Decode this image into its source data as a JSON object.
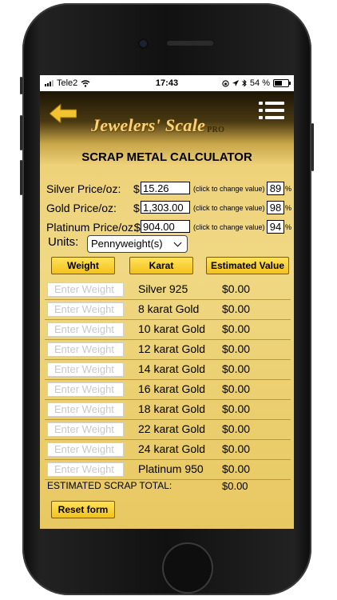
{
  "status": {
    "carrier": "Tele2",
    "time": "17:43",
    "battery": "54 %",
    "battery_level": 0.54
  },
  "header": {
    "logo_text": "Jewelers' Scale",
    "logo_pro": "PRO"
  },
  "title": "SCRAP METAL CALCULATOR",
  "prices": [
    {
      "label": "Silver Price/oz:",
      "currency": "$",
      "value": "15.26",
      "hint": "(click to change value)",
      "percent": "89",
      "percent_sign": "%"
    },
    {
      "label": "Gold Price/oz:",
      "currency": "$",
      "value": "1,303.00",
      "hint": "(click to change value)",
      "percent": "98",
      "percent_sign": "%"
    },
    {
      "label": "Platinum Price/oz:",
      "currency": "$",
      "value": "904.00",
      "hint": "(click to change value)",
      "percent": "94",
      "percent_sign": "%"
    }
  ],
  "units": {
    "label": "Units:",
    "selected": "Pennyweight(s)"
  },
  "columns": {
    "weight": "Weight",
    "karat": "Karat",
    "estimated_value": "Estimated Value"
  },
  "weight_placeholder": "Enter Weight",
  "rows": [
    {
      "name": "Silver 925",
      "value": "$0.00"
    },
    {
      "name": "8 karat Gold",
      "value": "$0.00"
    },
    {
      "name": "10 karat Gold",
      "value": "$0.00"
    },
    {
      "name": "12 karat Gold",
      "value": "$0.00"
    },
    {
      "name": "14 karat Gold",
      "value": "$0.00"
    },
    {
      "name": "16 karat Gold",
      "value": "$0.00"
    },
    {
      "name": "18 karat Gold",
      "value": "$0.00"
    },
    {
      "name": "22 karat Gold",
      "value": "$0.00"
    },
    {
      "name": "24 karat Gold",
      "value": "$0.00"
    },
    {
      "name": "Platinum 950",
      "value": "$0.00"
    }
  ],
  "total": {
    "label": "ESTIMATED SCRAP TOTAL:",
    "value": "$0.00"
  },
  "reset_label": "Reset form",
  "colors": {
    "gold_button": "#f3c21c",
    "arrow": "#f2c230",
    "background_gold": "#f0d884"
  },
  "icons": {
    "back": "back-arrow-icon",
    "menu": "menu-icon"
  }
}
